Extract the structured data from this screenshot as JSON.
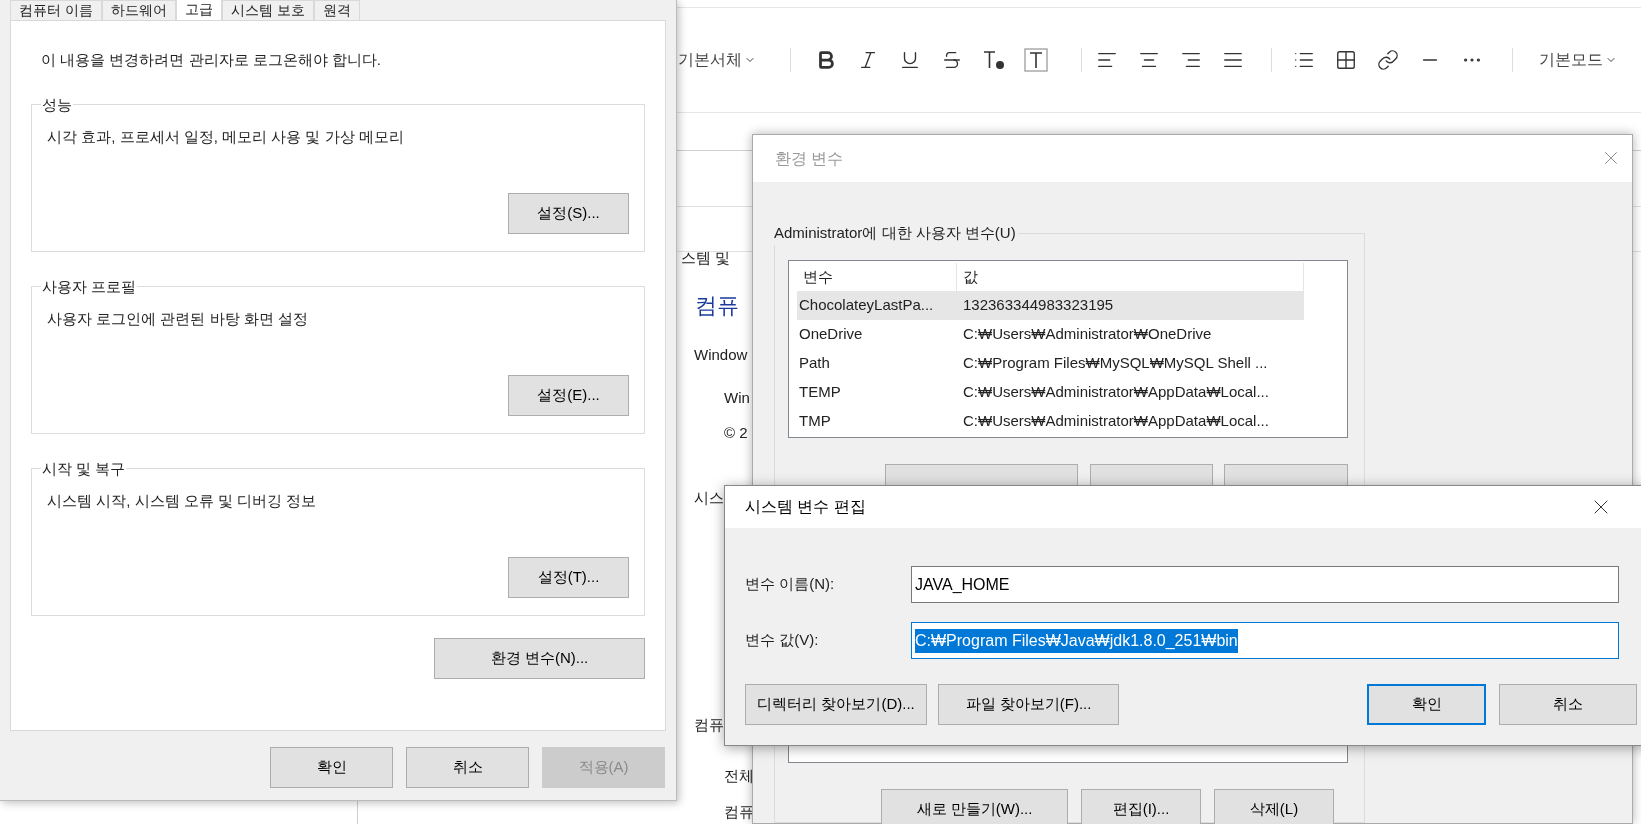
{
  "editor_toolbar": {
    "font_menu": "기본서체",
    "mode_menu": "기본모드",
    "tool_groups": [
      [
        {
          "kind": "bold"
        },
        {
          "kind": "italic"
        },
        {
          "kind": "underline"
        },
        {
          "kind": "strikethrough"
        },
        {
          "kind": "text-color"
        },
        {
          "kind": "text-background"
        }
      ],
      [
        {
          "kind": "align-left"
        },
        {
          "kind": "align-center"
        },
        {
          "kind": "align-right"
        },
        {
          "kind": "align-justify"
        }
      ],
      [
        {
          "kind": "bullet-list"
        },
        {
          "kind": "table"
        },
        {
          "kind": "link"
        },
        {
          "kind": "horizontal-rule"
        },
        {
          "kind": "more"
        }
      ]
    ]
  },
  "control_panel": {
    "fragments": [
      {
        "text": "스템 및",
        "kind": "text"
      },
      {
        "text": "컴퓨",
        "kind": "heading"
      },
      {
        "text": "Window",
        "kind": "text"
      },
      {
        "text": "Win",
        "kind": "text"
      },
      {
        "text": "© 2",
        "kind": "text"
      },
      {
        "text": "시스",
        "kind": "text"
      },
      {
        "text": "컴퓨",
        "kind": "text"
      },
      {
        "text": "전체",
        "kind": "text"
      },
      {
        "text": "컴퓨",
        "kind": "text"
      }
    ]
  },
  "system_properties": {
    "tabs": [
      {
        "label": "컴퓨터 이름",
        "selected": false
      },
      {
        "label": "하드웨어",
        "selected": false
      },
      {
        "label": "고급",
        "selected": true
      },
      {
        "label": "시스템 보호",
        "selected": false
      },
      {
        "label": "원격",
        "selected": false
      }
    ],
    "notice": "이 내용을 변경하려면 관리자로 로그온해야 합니다.",
    "groups": [
      {
        "title": "성능",
        "description": "시각 효과, 프로세서 일정, 메모리 사용 및 가상 메모리",
        "button": "설정(S)..."
      },
      {
        "title": "사용자 프로필",
        "description": "사용자 로그인에 관련된 바탕 화면 설정",
        "button": "설정(E)..."
      },
      {
        "title": "시작 및 복구",
        "description": "시스템 시작, 시스템 오류 및 디버깅 정보",
        "button": "설정(T)..."
      }
    ],
    "env_button": "환경 변수(N)...",
    "buttons": [
      {
        "label": "확인",
        "disabled": false
      },
      {
        "label": "취소",
        "disabled": false
      },
      {
        "label": "적용(A)",
        "disabled": true
      }
    ]
  },
  "env_dialog": {
    "title": "환경 변수",
    "user_group": "Administrator에 대한 사용자 변수(U)",
    "columns": [
      "변수",
      "값"
    ],
    "rows": [
      {
        "name": "ChocolateyLastPa...",
        "value": "132363344983323195",
        "selected": true
      },
      {
        "name": "OneDrive",
        "value": "C:₩Users₩Administrator₩OneDrive",
        "selected": false
      },
      {
        "name": "Path",
        "value": "C:₩Program Files₩MySQL₩MySQL Shell ...",
        "selected": false
      },
      {
        "name": "TEMP",
        "value": "C:₩Users₩Administrator₩AppData₩Local...",
        "selected": false
      },
      {
        "name": "TMP",
        "value": "C:₩Users₩Administrator₩AppData₩Local...",
        "selected": false
      }
    ],
    "system_buttons": [
      "새로 만들기(W)...",
      "편집(I)...",
      "삭제(L)"
    ]
  },
  "edit_dialog": {
    "title": "시스템 변수 편집",
    "fields": [
      {
        "label": "변수 이름(N):",
        "value": "JAVA_HOME",
        "focused": false,
        "text_selected": false
      },
      {
        "label": "변수 값(V):",
        "value": "C:₩Program Files₩Java₩jdk1.8.0_251₩bin",
        "focused": true,
        "text_selected": true
      }
    ],
    "left_buttons": [
      "디렉터리 찾아보기(D)...",
      "파일 찾아보기(F)..."
    ],
    "right_buttons": [
      {
        "label": "확인",
        "default": true
      },
      {
        "label": "취소",
        "default": false
      }
    ]
  }
}
